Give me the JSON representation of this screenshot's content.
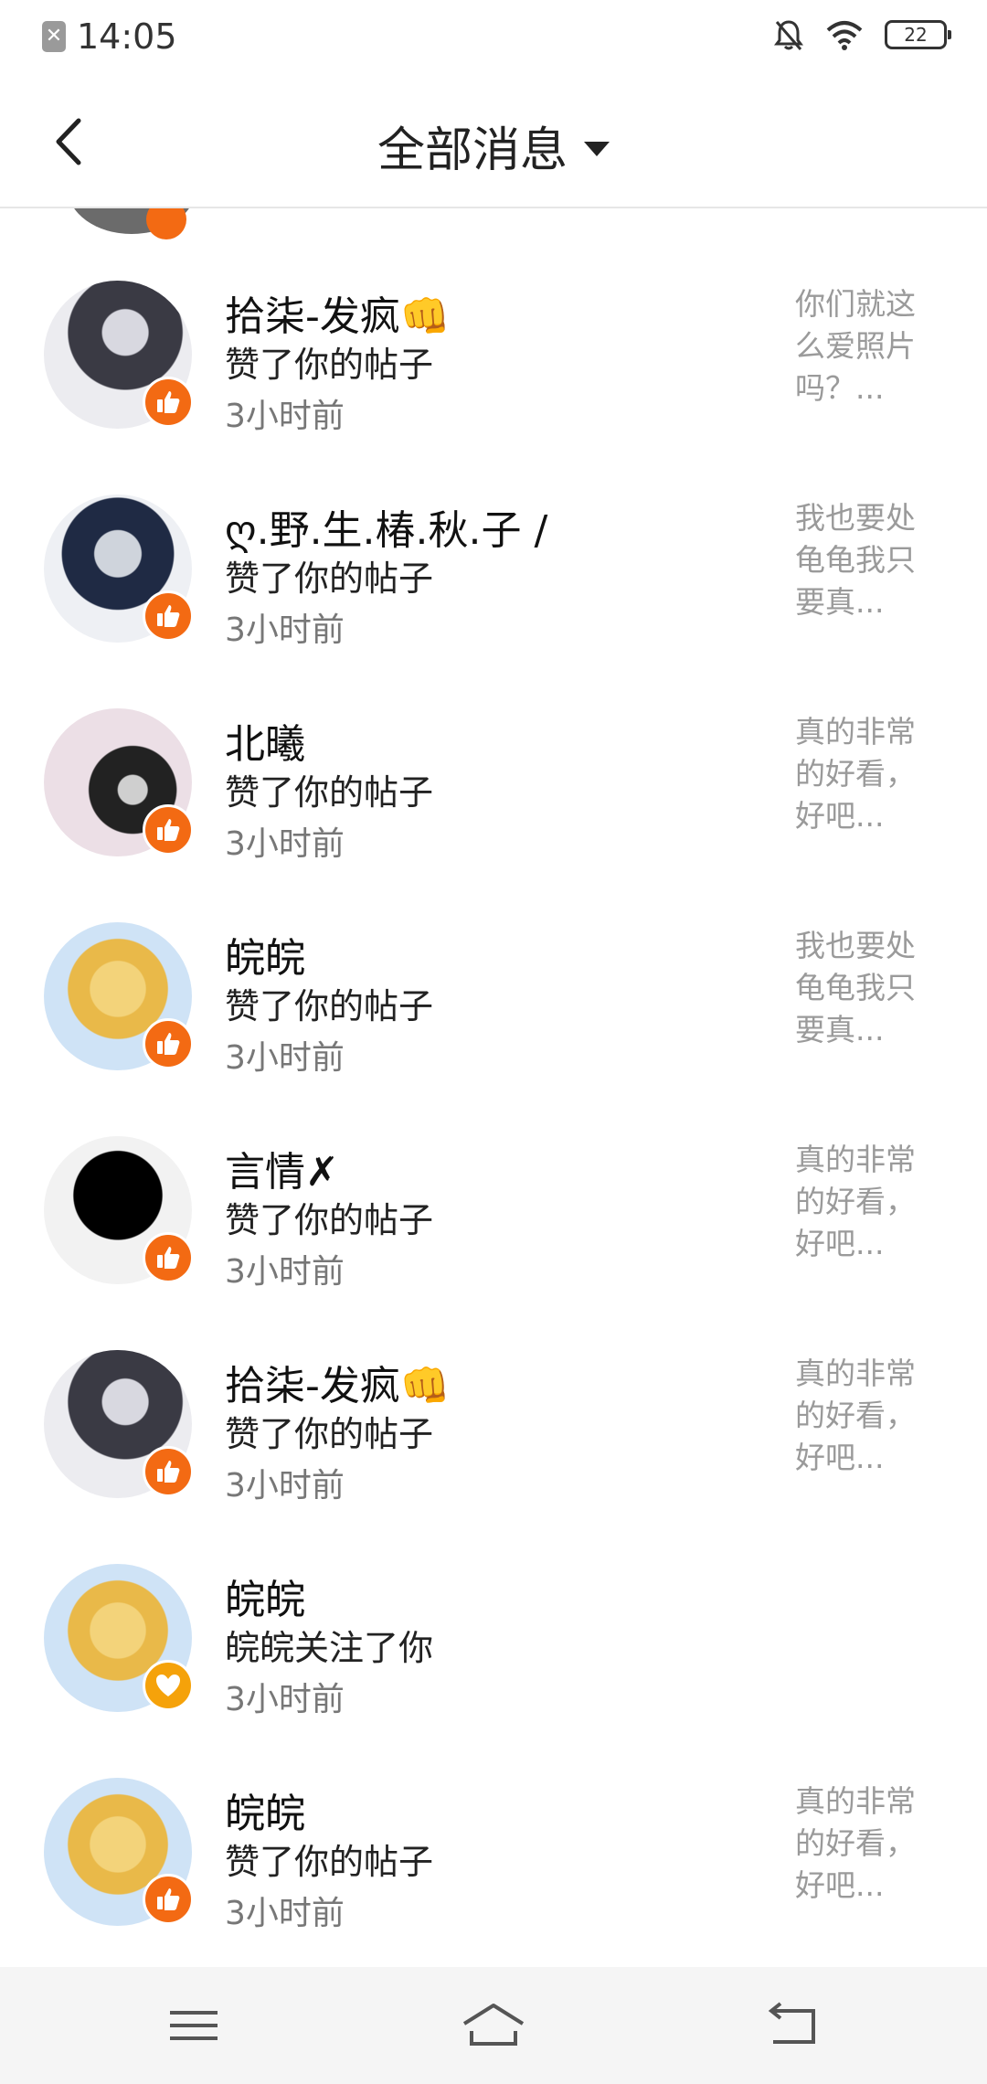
{
  "status_bar": {
    "time": "14:05",
    "battery": "22",
    "notif_icon": "app-notification-icon"
  },
  "header": {
    "title": "全部消息"
  },
  "notifications": [
    {
      "name": "拾柒-发疯👊",
      "action": "赞了你的帖子",
      "time": "3小时前",
      "preview": "你们就这么爱照片吗？...",
      "badge": "like"
    },
    {
      "name": "ღ.野.生.椿.秋.子 /",
      "action": "赞了你的帖子",
      "time": "3小时前",
      "preview": "我也要处龟龟我只要真...",
      "badge": "like"
    },
    {
      "name": "北曦",
      "action": "赞了你的帖子",
      "time": "3小时前",
      "preview": "真的非常的好看，好吧...",
      "badge": "like"
    },
    {
      "name": "皖皖",
      "action": "赞了你的帖子",
      "time": "3小时前",
      "preview": "我也要处龟龟我只要真...",
      "badge": "like"
    },
    {
      "name": "言情✗",
      "action": "赞了你的帖子",
      "time": "3小时前",
      "preview": "真的非常的好看，好吧...",
      "badge": "like"
    },
    {
      "name": "拾柒-发疯👊",
      "action": "赞了你的帖子",
      "time": "3小时前",
      "preview": "真的非常的好看，好吧...",
      "badge": "like"
    },
    {
      "name": "皖皖",
      "action": "皖皖关注了你",
      "time": "3小时前",
      "preview": "",
      "badge": "follow"
    },
    {
      "name": "皖皖",
      "action": "赞了你的帖子",
      "time": "3小时前",
      "preview": "真的非常的好看，好吧...",
      "badge": "like"
    }
  ],
  "colors": {
    "like_badge": "#f36a13",
    "follow_badge": "#f5a20a",
    "preview_text": "#9a9a9a"
  },
  "nav": {
    "menu_icon": "menu-icon",
    "home_icon": "home-icon",
    "back_icon": "back-icon"
  }
}
